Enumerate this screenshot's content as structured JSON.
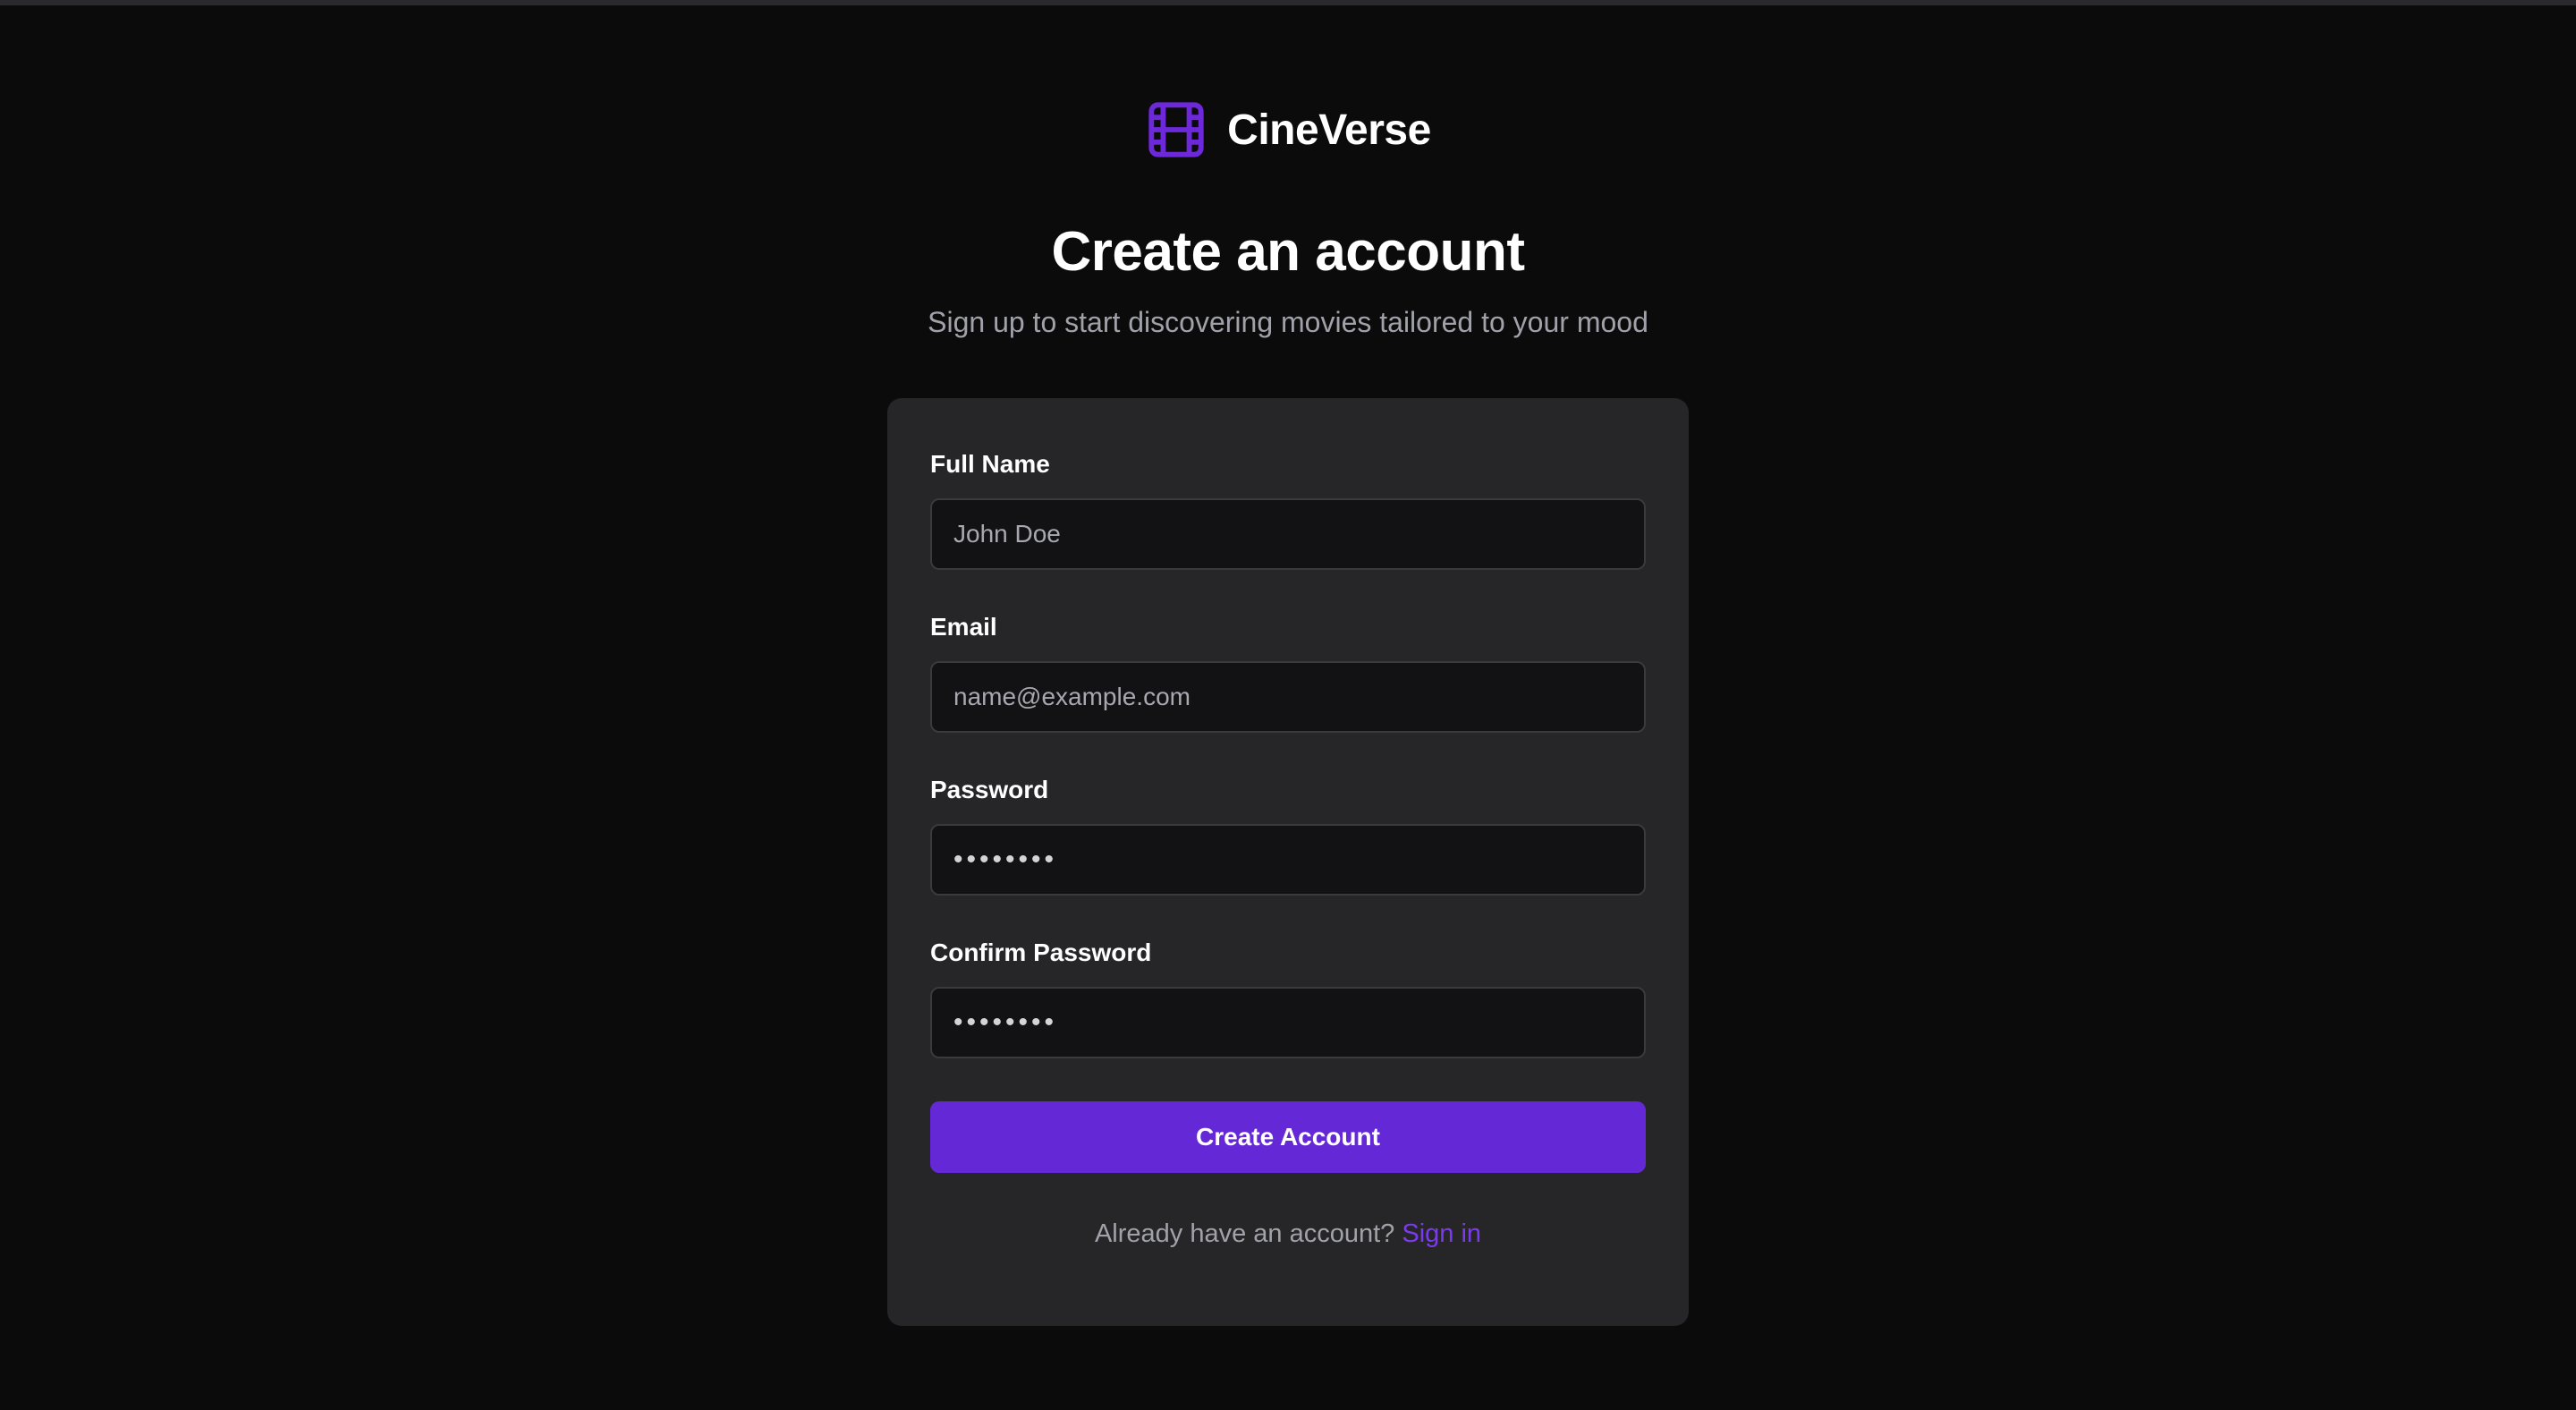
{
  "brand": {
    "name": "CineVerse",
    "icon": "film-icon",
    "accent": "#6d28d9"
  },
  "header": {
    "title": "Create an account",
    "subtitle": "Sign up to start discovering movies tailored to your mood"
  },
  "form": {
    "full_name": {
      "label": "Full Name",
      "placeholder": "John Doe"
    },
    "email": {
      "label": "Email",
      "placeholder": "name@example.com"
    },
    "password": {
      "label": "Password",
      "value": "••••••••"
    },
    "confirm_password": {
      "label": "Confirm Password",
      "value": "••••••••"
    },
    "submit_label": "Create Account",
    "submit_color": "#6428d6"
  },
  "footer": {
    "prompt": "Already have an account?",
    "link_label": "Sign in"
  }
}
